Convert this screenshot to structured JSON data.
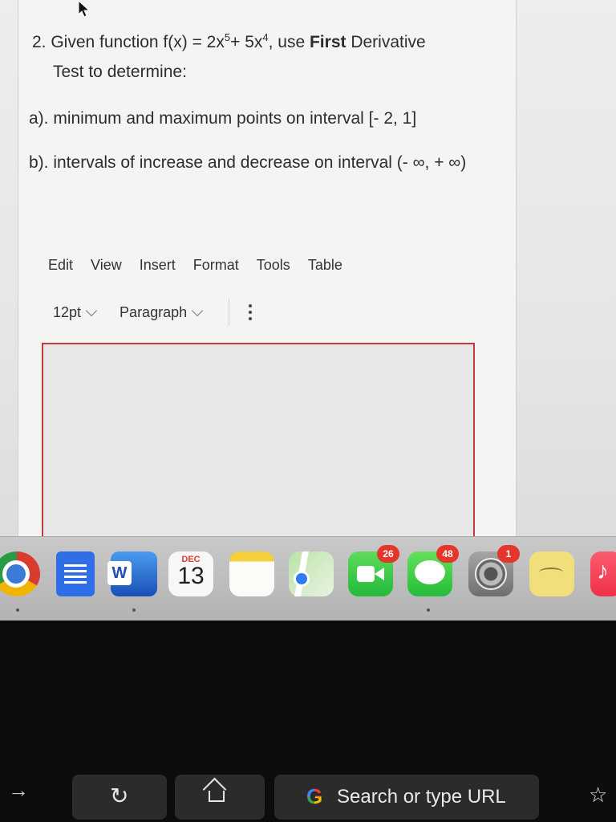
{
  "question": {
    "line1_prefix": "2. Given function f(x) = 2x",
    "exp1": "5",
    "line1_mid": "+ 5x",
    "exp2": "4",
    "line1_after": ", use ",
    "line1_bold": "First",
    "line1_end": " Derivative",
    "line2": "Test to determine:",
    "part_a": "a). minimum and maximum points on interval [- 2, 1]",
    "part_b": "b). intervals of increase and decrease on interval (- ∞, + ∞)"
  },
  "menubar": [
    "Edit",
    "View",
    "Insert",
    "Format",
    "Tools",
    "Table"
  ],
  "toolbar": {
    "font_size": "12pt",
    "block_format": "Paragraph"
  },
  "dock": {
    "word_letter": "W",
    "calendar_month": "DEC",
    "calendar_day": "13",
    "facetime_badge": "26",
    "messages_badge": "48",
    "settings_badge": "1"
  },
  "touchbar": {
    "search_label": "Search or type URL",
    "google_letter": "G"
  }
}
